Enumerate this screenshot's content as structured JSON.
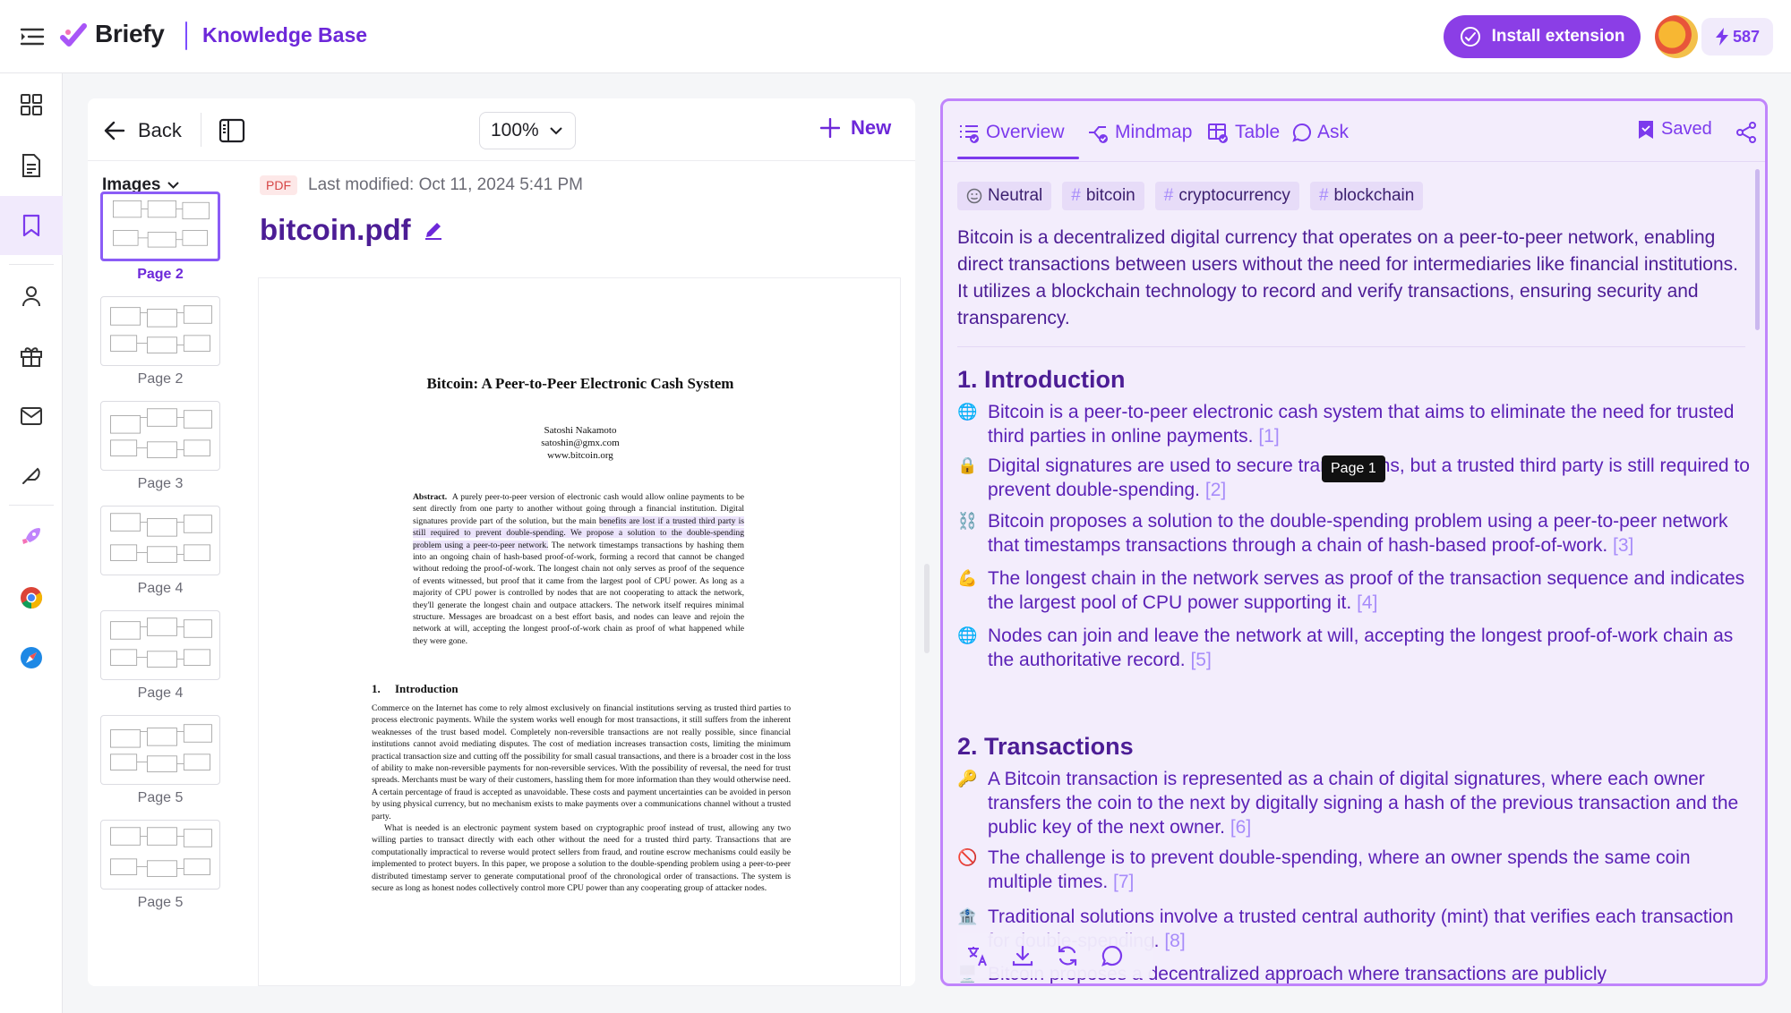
{
  "header": {
    "brand": "Briefy",
    "section_title": "Knowledge Base",
    "install_label": "Install extension",
    "credits": "587"
  },
  "sidebar": {
    "items": [
      "dashboard-icon",
      "document-icon",
      "bookmark-icon",
      "user-icon",
      "gift-icon",
      "mail-icon",
      "feather-icon",
      "rocket-icon",
      "chrome-icon",
      "safari-icon"
    ],
    "active_index": 2
  },
  "doc": {
    "back_label": "Back",
    "zoom": "100%",
    "new_label": "New",
    "thumbs_header": "Images",
    "thumbnails": [
      {
        "label": "Page 2",
        "active": true
      },
      {
        "label": "Page 2",
        "active": false
      },
      {
        "label": "Page 3",
        "active": false
      },
      {
        "label": "Page 4",
        "active": false
      },
      {
        "label": "Page 4",
        "active": false
      },
      {
        "label": "Page 5",
        "active": false
      },
      {
        "label": "Page 5",
        "active": false
      }
    ],
    "file_type": "PDF",
    "last_modified": "Last modified: Oct 11, 2024 5:41 PM",
    "file_name": "bitcoin.pdf",
    "page": {
      "title": "Bitcoin: A Peer-to-Peer Electronic Cash System",
      "author": "Satoshi Nakamoto",
      "email": "satoshin@gmx.com",
      "site": "www.bitcoin.org",
      "abstract_label": "Abstract.",
      "abstract_pre": "A purely peer-to-peer version of electronic cash would allow online payments to be sent directly from one party to another without going through a financial institution. Digital signatures provide part of the solution, but the main ",
      "abstract_hl": "benefits are lost if a trusted third party is still required to prevent double-spending. We propose a solution to the double-spending problem using a peer-to-peer network.",
      "abstract_post": " The network timestamps transactions by hashing them into an ongoing chain of hash-based proof-of-work, forming a record that cannot be changed without redoing the proof-of-work. The longest chain not only serves as proof of the sequence of events witnessed, but proof that it came from the largest pool of CPU power. As long as a majority of CPU power is controlled by nodes that are not cooperating to attack the network, they'll generate the longest chain and outpace attackers. The network itself requires minimal structure. Messages are broadcast on a best effort basis, and nodes can leave and rejoin the network at will, accepting the longest proof-of-work chain as proof of what happened while they were gone.",
      "intro_heading": "1.     Introduction",
      "intro_p1": "Commerce on the Internet has come to rely almost exclusively on financial institutions serving as trusted third parties to process electronic payments. While the system works well enough for most transactions, it still suffers from the inherent weaknesses of the trust based model. Completely non-reversible transactions are not really possible, since financial institutions cannot avoid mediating disputes. The cost of mediation increases transaction costs, limiting the minimum practical transaction size and cutting off the possibility for small casual transactions, and there is a broader cost in the loss of ability to make non-reversible payments for non-reversible services. With the possibility of reversal, the need for trust spreads. Merchants must be wary of their customers, hassling them for more information than they would otherwise need. A certain percentage of fraud is accepted as unavoidable. These costs and payment uncertainties can be avoided in person by using physical currency, but no mechanism exists to make payments over a communications channel without a trusted party.",
      "intro_p2": "What is needed is an electronic payment system based on cryptographic proof instead of trust, allowing any two willing parties to transact directly with each other without the need for a trusted third party. Transactions that are computationally impractical to reverse would protect sellers from fraud, and routine escrow mechanisms could easily be implemented to protect buyers. In this paper, we propose a solution to the double-spending problem using a peer-to-peer distributed timestamp server to generate computational proof of the chronological order of transactions. The system is secure as long as honest nodes collectively control more CPU power than any cooperating group of attacker nodes."
    }
  },
  "summary": {
    "tabs": [
      "Overview",
      "Mindmap",
      "Table",
      "Ask"
    ],
    "active_tab": "Overview",
    "saved_label": "Saved",
    "tags": [
      {
        "text": "Neutral",
        "kind": "sentiment"
      },
      {
        "text": "bitcoin",
        "kind": "hash"
      },
      {
        "text": "cryptocurrency",
        "kind": "hash"
      },
      {
        "text": "blockchain",
        "kind": "hash"
      }
    ],
    "tag_hash": "#",
    "overview": "Bitcoin is a decentralized digital currency that operates on a peer-to-peer network, enabling direct transactions between users without the need for intermediaries like financial institutions. It utilizes a blockchain technology to record and verify transactions, ensuring security and transparency.",
    "sections": [
      {
        "heading": "1. Introduction",
        "bullets": [
          {
            "emoji": "🌐",
            "text": "Bitcoin is a peer-to-peer electronic cash system that aims to eliminate the need for trusted third parties in online payments.",
            "ref": "[1]"
          },
          {
            "emoji": "🔒",
            "text": "Digital signatures are used to secure transactions, but a trusted third party is still required to prevent double-spending.",
            "ref": "[2]"
          },
          {
            "emoji": "⛓️",
            "text": "Bitcoin proposes a solution to the double-spending problem using a peer-to-peer network that timestamps transactions through a chain of hash-based proof-of-work.",
            "ref": "[3]"
          },
          {
            "emoji": "💪",
            "text": "The longest chain in the network serves as proof of the transaction sequence and indicates the largest pool of CPU power supporting it.",
            "ref": "[4]"
          },
          {
            "emoji": "🌐",
            "text": "Nodes can join and leave the network at will, accepting the longest proof-of-work chain as the authoritative record.",
            "ref": "[5]"
          }
        ]
      },
      {
        "heading": "2. Transactions",
        "bullets": [
          {
            "emoji": "🔑",
            "text": "A Bitcoin transaction is represented as a chain of digital signatures, where each owner transfers the coin to the next by digitally signing a hash of the previous transaction and the public key of the next owner.",
            "ref": "[6]"
          },
          {
            "emoji": "🚫",
            "text": "The challenge is to prevent double-spending, where an owner spends the same coin multiple times.",
            "ref": "[7]"
          },
          {
            "emoji": "🏦",
            "text": "Traditional solutions involve a trusted central authority (mint) that verifies each transaction for double-spending.",
            "ref": "[8]"
          },
          {
            "emoji": "🖥️",
            "text": "Bitcoin proposes a decentralized approach where transactions are publicly",
            "ref": ""
          }
        ]
      }
    ],
    "tooltip": "Page 1",
    "actions": [
      "translate-icon",
      "download-icon",
      "refresh-icon",
      "chat-icon"
    ]
  },
  "colors": {
    "accent": "#7c3aed",
    "accent_dark": "#4c1d95",
    "install_bg": "#8b3ee6",
    "panel_bg": "#f3edfc",
    "panel_border": "#c084fc"
  }
}
